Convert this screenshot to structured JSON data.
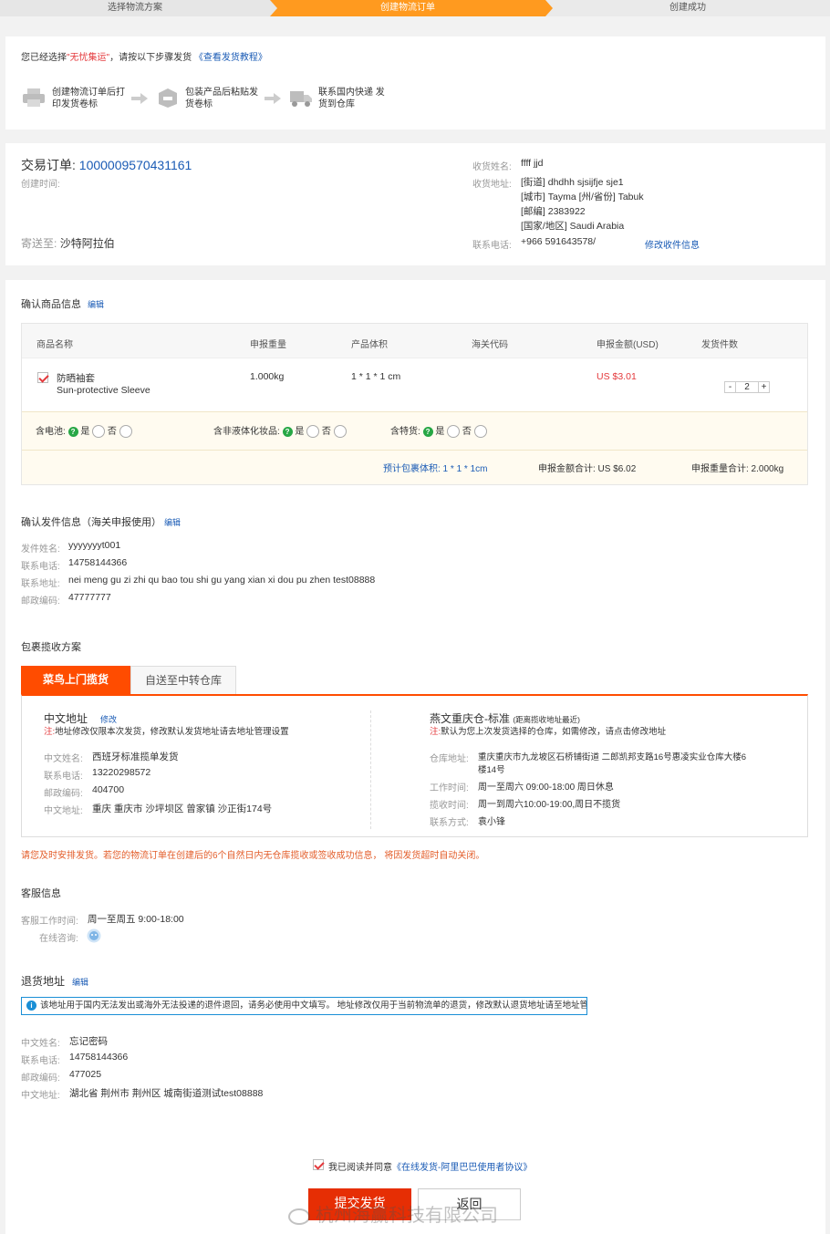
{
  "steps": [
    "选择物流方案",
    "创建物流订单",
    "创建成功"
  ],
  "intro": {
    "prefix": "您已经选择",
    "service": "\"无忧集运\"",
    "middle": "，请按以下步骤发货",
    "tutorial_link": "《查看发货教程》",
    "step1": "创建物流订单后打印发货卷标",
    "step2": "包装产品后粘贴发货卷标",
    "step3": "联系国内快递 发货到仓库"
  },
  "order": {
    "label": "交易订单:",
    "number": "1000009570431161",
    "created_label": "创建时间:",
    "ship_to_label": "寄送至:",
    "ship_to": "沙特阿拉伯",
    "recipient_name_label": "收货姓名:",
    "recipient_name": "ffff jjd",
    "address_label": "收货地址:",
    "address_lines": [
      "[街道] dhdhh sjsijfje sje1",
      "[城市] Tayma [州/省份] Tabuk",
      "[邮编] 2383922",
      "[国家/地区] Saudi Arabia"
    ],
    "phone_label": "联系电话:",
    "phone": "+966 591643578/",
    "modify_link": "修改收件信息"
  },
  "products": {
    "title": "确认商品信息",
    "edit": "编辑",
    "columns": [
      "商品名称",
      "申报重量",
      "产品体积",
      "海关代码",
      "申报金额(USD)",
      "发货件数"
    ],
    "row": {
      "name_cn": "防晒袖套",
      "name_en": "Sun-protective Sleeve",
      "weight": "1.000kg",
      "volume": "1 * 1 * 1 cm",
      "hs_code": "",
      "amount": "US $3.01",
      "qty_minus": "-",
      "qty": "2",
      "qty_plus": "+"
    },
    "battery_label": "含电池:",
    "liquid_label": "含非液体化妆品:",
    "special_label": "含特货:",
    "yes": "是",
    "no": "否",
    "est_volume": "预计包裹体积: 1 * 1 * 1cm",
    "total_amount": "申报金额合计: US $6.02",
    "total_weight": "申报重量合计: 2.000kg"
  },
  "sender": {
    "title": "确认发件信息（海关申报使用）",
    "edit": "编辑",
    "name_label": "发件姓名:",
    "name": "yyyyyyyt001",
    "phone_label": "联系电话:",
    "phone": "14758144366",
    "address_label": "联系地址:",
    "address": "nei meng gu zi zhi qu bao tou shi gu yang xian xi dou pu zhen test08888",
    "zip_label": "邮政编码:",
    "zip": "47777777"
  },
  "pickup": {
    "title": "包裹揽收方案",
    "tab_active": "菜鸟上门揽货",
    "tab_other": "自送至中转仓库",
    "left_title": "中文地址",
    "left_modify": "修改",
    "left_note_prefix": "注:",
    "left_note": "地址修改仅限本次发货，修改默认发货地址请去地址管理设置",
    "cn_name_label": "中文姓名:",
    "cn_name": "西班牙标准揽单发货",
    "phone_label": "联系电话:",
    "phone": "13220298572",
    "zip_label": "邮政编码:",
    "zip": "404700",
    "addr_label": "中文地址:",
    "addr": "重庆 重庆市 沙坪坝区 曾家镇 沙正街174号",
    "right_title": "燕文重庆仓-标准",
    "right_sub": "(距离揽收地址最近)",
    "right_note_prefix": "注:",
    "right_note": "默认为您上次发货选择的仓库，如需修改，请点击修改地址",
    "wh_addr_label": "仓库地址:",
    "wh_addr_1": "重庆重庆市九龙坡区石桥铺街道 二郎凯邦支路16号惠凌实业仓库大楼6",
    "wh_addr_2": "楼14号",
    "hours_label": "工作时间:",
    "hours": "周一至周六 09:00-18:00 周日休息",
    "collect_label": "揽收时间:",
    "collect": "周一到周六10:00-19:00,周日不揽货",
    "contact_label": "联系方式:",
    "contact": "袁小锋"
  },
  "warning": "请您及时安排发货。若您的物流订单在创建后的6个自然日内无仓库揽收或签收成功信息， 将因发货超时自动关闭。",
  "service": {
    "title": "客服信息",
    "hours_label": "客服工作时间:",
    "hours": "周一至周五 9:00-18:00",
    "online_label": "在线咨询:"
  },
  "return_addr": {
    "title": "退货地址",
    "edit": "编辑",
    "notice": "该地址用于国内无法发出或海外无法投递的退件退回，请务必使用中文填写。 地址修改仅用于当前物流单的退货，修改默认退货地址请至地址管理设置",
    "name_label": "中文姓名:",
    "name": "忘记密码",
    "phone_label": "联系电话:",
    "phone": "14758144366",
    "zip_label": "邮政编码:",
    "zip": "477025",
    "addr_label": "中文地址:",
    "addr": "湖北省 荆州市 荆州区 城南街道测试test08888"
  },
  "agree": {
    "text": "我已阅读并同意",
    "link": "《在线发货-阿里巴巴使用者协议》"
  },
  "buttons": {
    "submit": "提交发货",
    "back": "返回"
  },
  "watermark": "杭州海赢科技有限公司"
}
